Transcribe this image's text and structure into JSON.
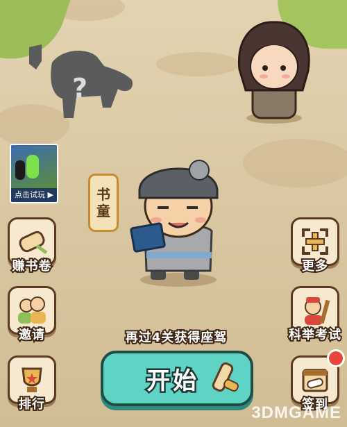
{
  "colors": {
    "accent": "#5fd3c4",
    "outline": "#3e2615",
    "tile": "#f7e9cf"
  },
  "trial_game": {
    "caption": "点击试玩 ▶"
  },
  "character": {
    "role_tag_chars": [
      "书",
      "童"
    ]
  },
  "left_menu": [
    {
      "id": "earn-scrolls",
      "label": "赚书卷",
      "icon": "scroll-icon"
    },
    {
      "id": "invite",
      "label": "邀请",
      "icon": "people-icon"
    },
    {
      "id": "ranking",
      "label": "排行",
      "icon": "trophy-icon"
    }
  ],
  "right_menu": [
    {
      "id": "more",
      "label": "更多",
      "icon": "plus-frame-icon"
    },
    {
      "id": "exam",
      "label": "科举考试",
      "icon": "scholar-icon"
    },
    {
      "id": "checkin",
      "label": "签到",
      "icon": "calendar-scroll-icon"
    }
  ],
  "progress_tip": "再过4关获得座驾",
  "start_button": {
    "label": "开始"
  },
  "watermark": "3DMGAME",
  "locked_mount": {
    "symbol": "?"
  }
}
